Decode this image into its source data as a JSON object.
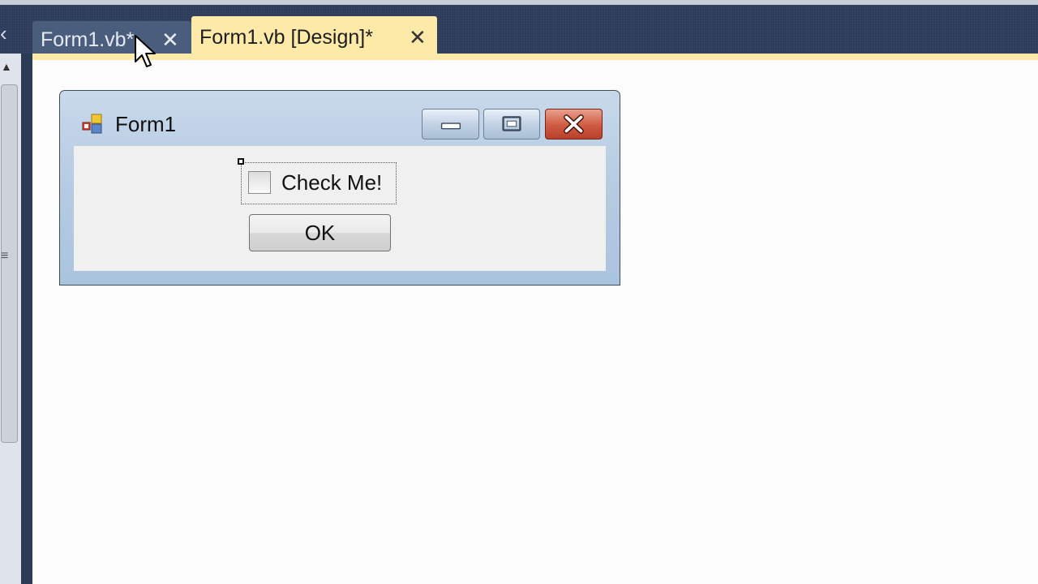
{
  "tabs": [
    {
      "label": "Form1.vb*",
      "active": false
    },
    {
      "label": "Form1.vb [Design]*",
      "active": true
    }
  ],
  "icons": {
    "tab_close": "✕",
    "tab_scroll_left": "‹",
    "scroll_up": "▲",
    "grip": "≡"
  },
  "form": {
    "title": "Form1",
    "checkbox": {
      "label": "Check Me!",
      "checked": false
    },
    "ok_button": "OK"
  },
  "colors": {
    "active_tab": "#fde9a8",
    "inactive_tab": "#4a5d7d",
    "tab_bar": "#2d3c5a",
    "close_button": "#cf5a42"
  }
}
